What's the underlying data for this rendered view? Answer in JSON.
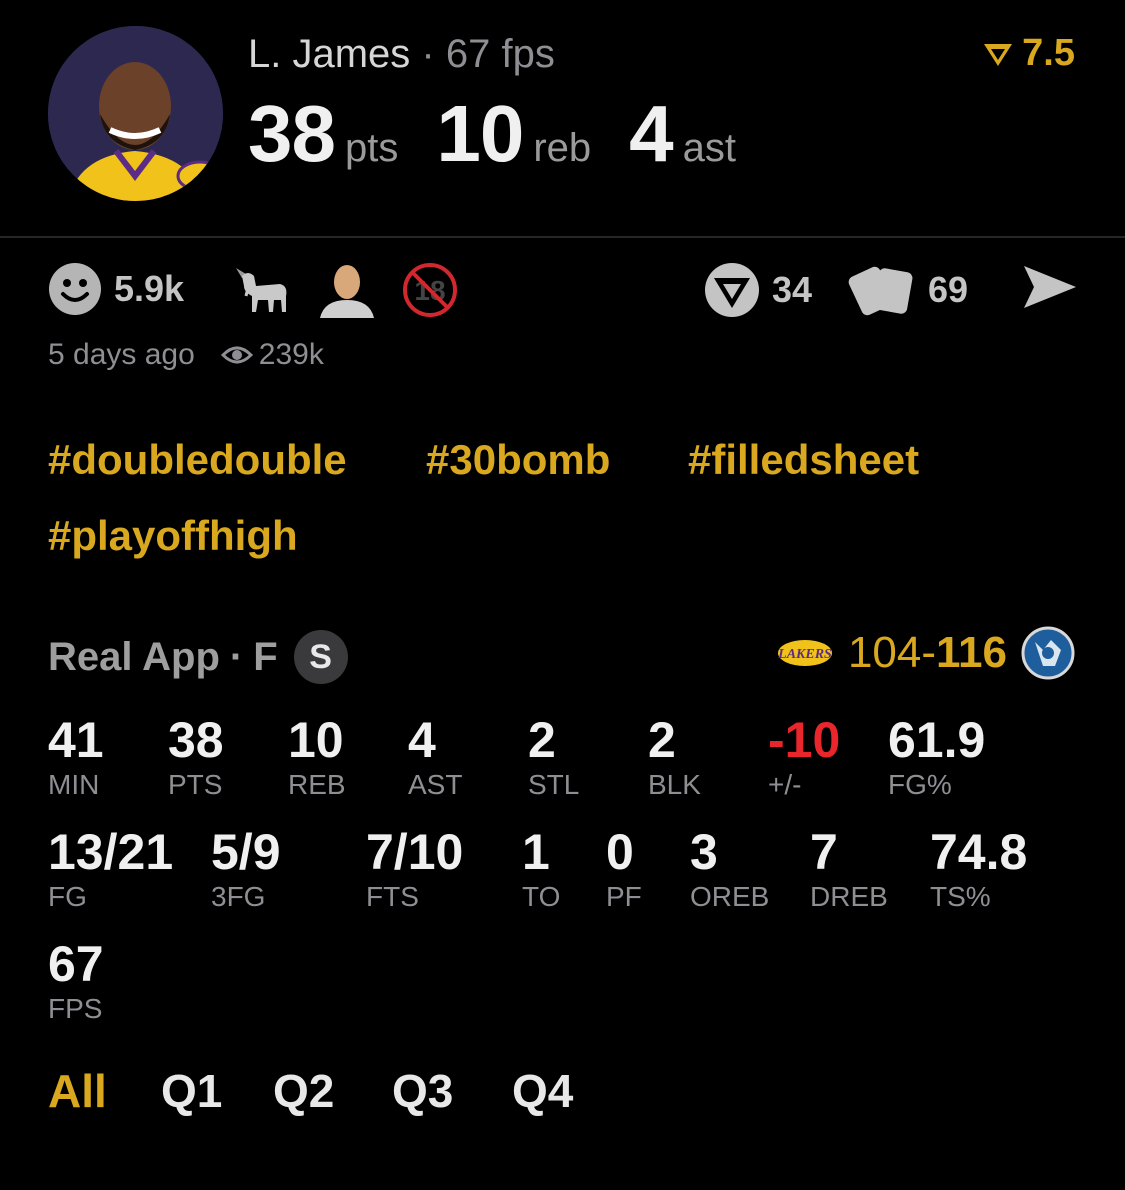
{
  "header": {
    "player_name": "L. James",
    "separator": "·",
    "fps_text": "67 fps",
    "rating": "7.5",
    "stats": [
      {
        "value": "38",
        "unit": "pts"
      },
      {
        "value": "10",
        "unit": "reb"
      },
      {
        "value": "4",
        "unit": "ast"
      }
    ]
  },
  "reactions": {
    "smile_count": "5.9k",
    "comment_count": "34",
    "share_count": "69"
  },
  "meta": {
    "time_ago": "5 days ago",
    "views": "239k"
  },
  "hashtags": [
    "#doubledouble",
    "#30bomb",
    "#filledsheet",
    "#playoffhigh"
  ],
  "game": {
    "source": "Real App",
    "separator": "·",
    "status": "F",
    "badge": "S",
    "score_home": "104",
    "score_dash": "-",
    "score_away": "116"
  },
  "stats_grid": [
    {
      "value": "41",
      "label": "MIN"
    },
    {
      "value": "38",
      "label": "PTS"
    },
    {
      "value": "10",
      "label": "REB"
    },
    {
      "value": "4",
      "label": "AST"
    },
    {
      "value": "2",
      "label": "STL"
    },
    {
      "value": "2",
      "label": "BLK"
    },
    {
      "value": "-10",
      "label": "+/-"
    },
    {
      "value": "61.9",
      "label": "FG%"
    },
    {
      "value": "13/21",
      "label": "FG"
    },
    {
      "value": "5/9",
      "label": "3FG"
    },
    {
      "value": "7/10",
      "label": "FTS"
    },
    {
      "value": "1",
      "label": "TO"
    },
    {
      "value": "0",
      "label": "PF"
    },
    {
      "value": "3",
      "label": "OREB"
    },
    {
      "value": "7",
      "label": "DREB"
    },
    {
      "value": "74.8",
      "label": "TS%"
    },
    {
      "value": "67",
      "label": "FPS"
    }
  ],
  "tabs": [
    "All",
    "Q1",
    "Q2",
    "Q3",
    "Q4"
  ],
  "colors": {
    "accent": "#d9a81e",
    "negative": "#e8262b",
    "muted": "#8e8e93"
  }
}
